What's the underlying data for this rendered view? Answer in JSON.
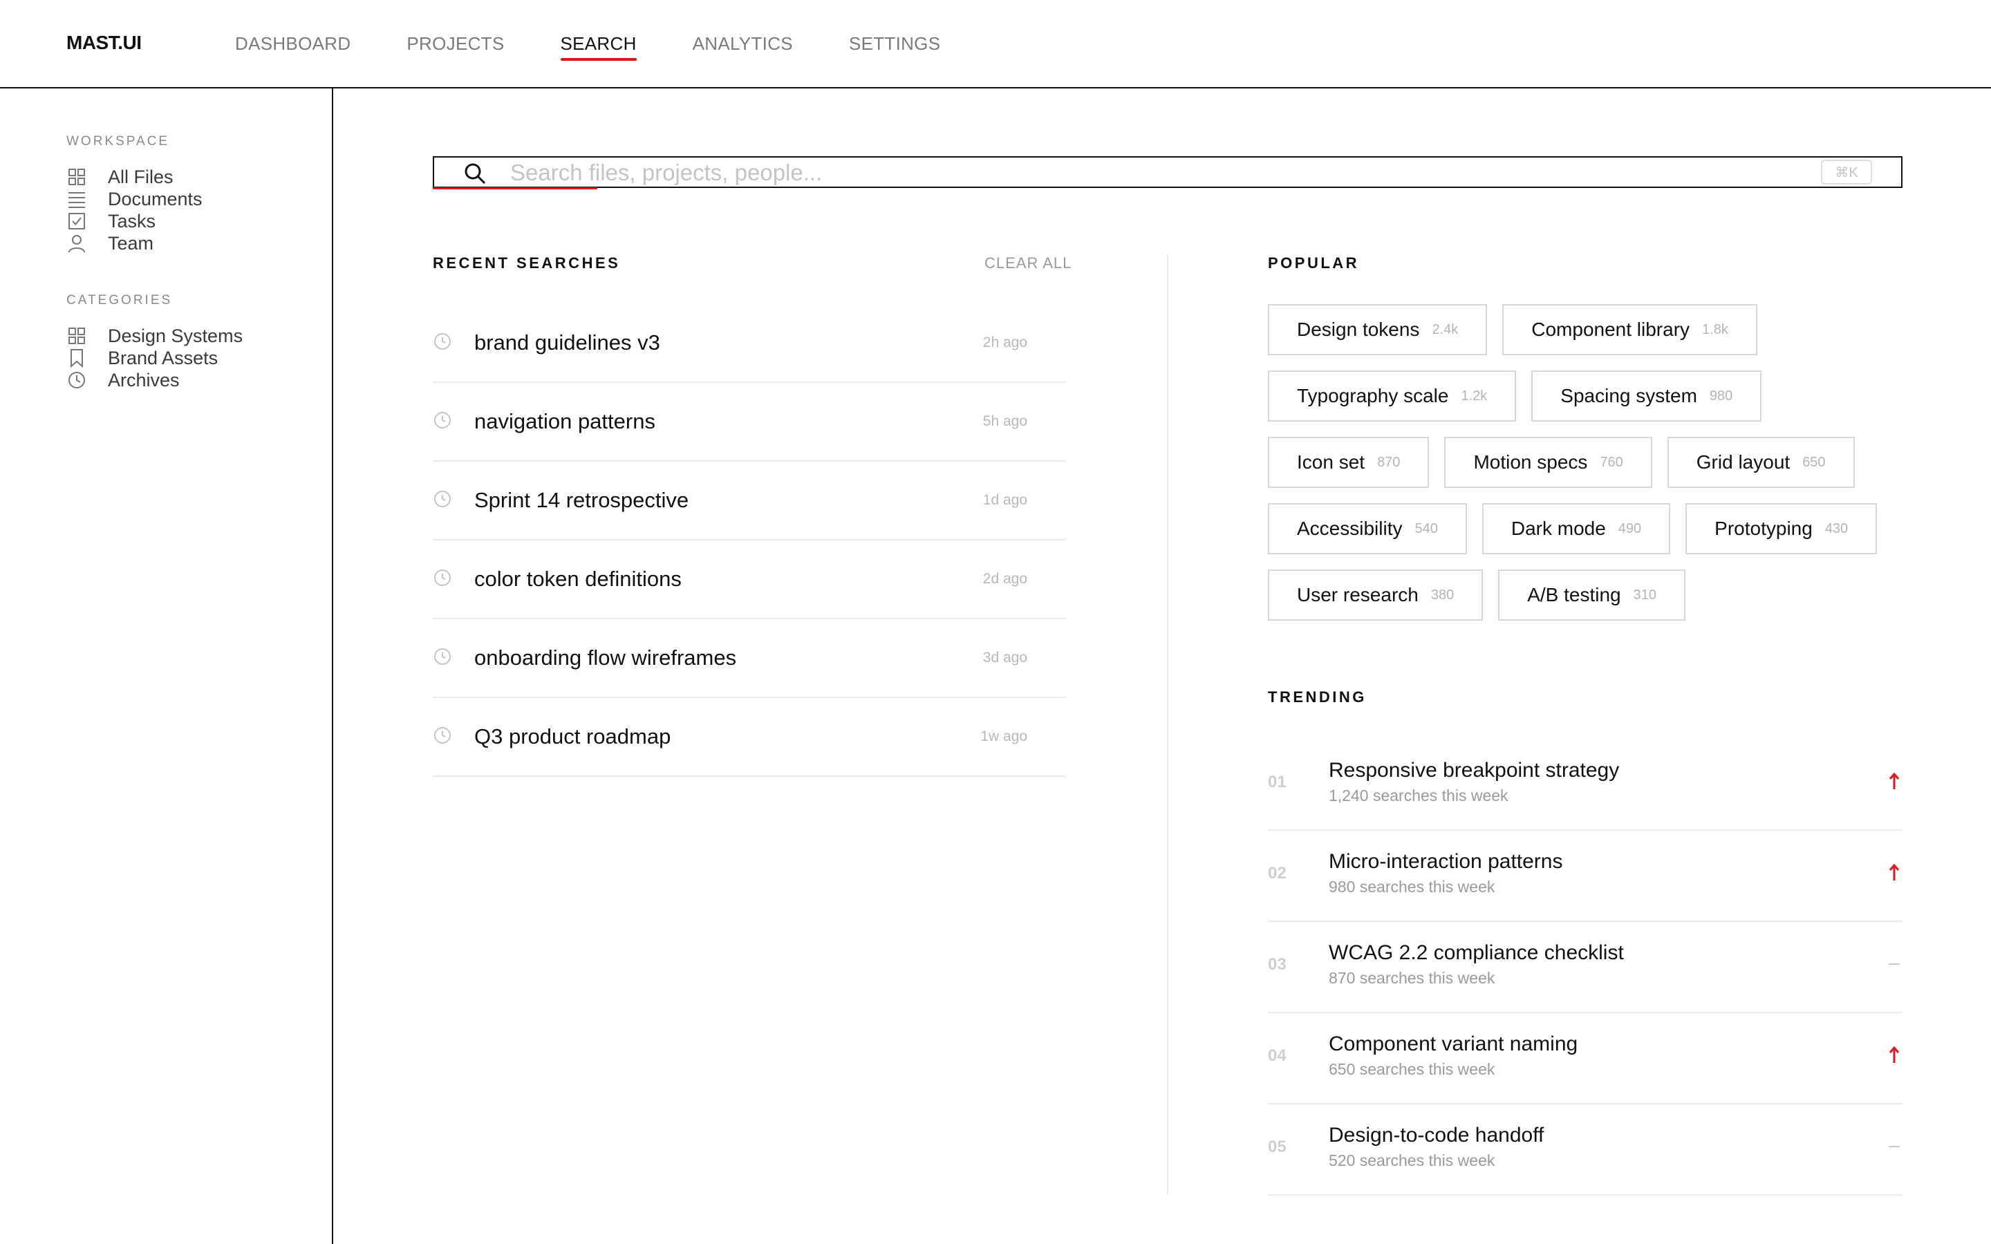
{
  "app": {
    "logo": "MAST.UI"
  },
  "nav": {
    "items": [
      {
        "label": "DASHBOARD"
      },
      {
        "label": "PROJECTS"
      },
      {
        "label": "SEARCH"
      },
      {
        "label": "ANALYTICS"
      },
      {
        "label": "SETTINGS"
      }
    ],
    "active": "SEARCH"
  },
  "sidebar": {
    "workspace_title": "WORKSPACE",
    "workspace": [
      {
        "label": "All Files",
        "icon": "grid-icon"
      },
      {
        "label": "Documents",
        "icon": "lines-icon"
      },
      {
        "label": "Tasks",
        "icon": "checkbox-icon"
      },
      {
        "label": "Team",
        "icon": "user-icon"
      }
    ],
    "categories_title": "CATEGORIES",
    "categories": [
      {
        "label": "Design Systems",
        "icon": "grid-icon"
      },
      {
        "label": "Brand Assets",
        "icon": "bookmark-icon"
      },
      {
        "label": "Archives",
        "icon": "clock-icon"
      }
    ]
  },
  "search": {
    "placeholder": "Search files, projects, people...",
    "value": "",
    "shortcut": "⌘K"
  },
  "recent": {
    "title": "RECENT SEARCHES",
    "clear_label": "CLEAR ALL",
    "items": [
      {
        "query": "brand guidelines v3",
        "time": "2h ago"
      },
      {
        "query": "navigation patterns",
        "time": "5h ago"
      },
      {
        "query": "Sprint 14 retrospective",
        "time": "1d ago"
      },
      {
        "query": "color token definitions",
        "time": "2d ago"
      },
      {
        "query": "onboarding flow wireframes",
        "time": "3d ago"
      },
      {
        "query": "Q3 product roadmap",
        "time": "1w ago"
      }
    ]
  },
  "popular": {
    "title": "POPULAR",
    "rows": [
      [
        {
          "name": "Design tokens",
          "count": "2.4k"
        },
        {
          "name": "Component library",
          "count": "1.8k"
        }
      ],
      [
        {
          "name": "Typography scale",
          "count": "1.2k"
        },
        {
          "name": "Spacing system",
          "count": "980"
        }
      ],
      [
        {
          "name": "Icon set",
          "count": "870"
        },
        {
          "name": "Motion specs",
          "count": "760"
        },
        {
          "name": "Grid layout",
          "count": "650"
        }
      ],
      [
        {
          "name": "Accessibility",
          "count": "540"
        },
        {
          "name": "Dark mode",
          "count": "490"
        },
        {
          "name": "Prototyping",
          "count": "430"
        }
      ],
      [
        {
          "name": "User research",
          "count": "380"
        },
        {
          "name": "A/B testing",
          "count": "310"
        }
      ]
    ]
  },
  "trending": {
    "title": "TRENDING",
    "items": [
      {
        "rank": "01",
        "title": "Responsive breakpoint strategy",
        "meta": "1,240 searches this week",
        "direction": "up"
      },
      {
        "rank": "02",
        "title": "Micro-interaction patterns",
        "meta": "980 searches this week",
        "direction": "up"
      },
      {
        "rank": "03",
        "title": "WCAG 2.2 compliance checklist",
        "meta": "870 searches this week",
        "direction": "flat"
      },
      {
        "rank": "04",
        "title": "Component variant naming",
        "meta": "650 searches this week",
        "direction": "up"
      },
      {
        "rank": "05",
        "title": "Design-to-code handoff",
        "meta": "520 searches this week",
        "direction": "flat"
      }
    ]
  },
  "colors": {
    "accent": "#e0161e",
    "text": "#111111",
    "muted": "#9a9a9a",
    "border": "#ebebeb"
  }
}
